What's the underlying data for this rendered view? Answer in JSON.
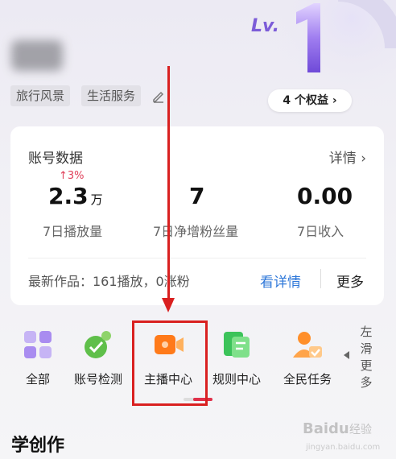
{
  "profile": {
    "tags": [
      "旅行风景",
      "生活服务"
    ]
  },
  "level": {
    "prefix": "Lv.",
    "number": "1",
    "rights_label": "4 个权益 ›"
  },
  "account_card": {
    "title": "账号数据",
    "detail_label": "详情 ›",
    "stats": [
      {
        "change": "↑3%",
        "value": "2.3",
        "unit": "万",
        "label": "7日播放量"
      },
      {
        "value": "7",
        "label": "7日净增粉丝量"
      },
      {
        "value": "0.00",
        "label": "7日收入"
      }
    ],
    "latest": "最新作品：161播放，0涨粉",
    "view_detail": "看详情",
    "more": "更多"
  },
  "shortcuts": [
    {
      "label": "全部",
      "icon": "grid-icon"
    },
    {
      "label": "账号检测",
      "icon": "shield-check-icon"
    },
    {
      "label": "主播中心",
      "icon": "video-camera-icon"
    },
    {
      "label": "规则中心",
      "icon": "document-icon"
    },
    {
      "label": "全民任务",
      "icon": "person-task-icon"
    }
  ],
  "slide_hint": "左滑更多",
  "section": {
    "title": "学创作"
  },
  "watermark": "Baidu 经验",
  "colors": {
    "accent": "#2f78d9",
    "annotation": "#d92020",
    "change_up": "#e0405a"
  }
}
